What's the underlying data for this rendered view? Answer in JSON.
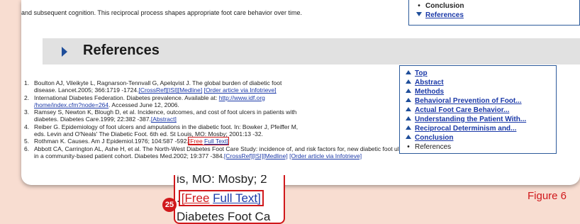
{
  "intro_text": "and subsequent cognition. This reciprocal process shapes appropriate foot care behavior over time.",
  "toc_top": {
    "items": [
      {
        "label": "Conclusion",
        "icon": "bullet-icon",
        "link": false
      },
      {
        "label": "References",
        "icon": "arrow-down-icon",
        "link": true
      }
    ]
  },
  "references_heading": "References",
  "references": [
    {
      "num": "1.",
      "line1": "Boulton AJ, Vileikyte L, Ragnarson-Tennvall G, Apelqvist J. The global burden of diabetic foot",
      "line2_text": "disease. Lancet.2005; 366:1719 -1724.",
      "links": [
        "[CrossRef]",
        "[ISI]",
        "[Medline]",
        "[Order article via Infotrieve]"
      ]
    },
    {
      "num": "2.",
      "line1_text": "International Diabetes Federation. Diabetes prevalence. Available at: ",
      "url1": "http://www.idf.org",
      "url2": "/home/index.cfm?node=264",
      "line2_text": ". Accessed June 12, 2006."
    },
    {
      "num": "3.",
      "line1": "Ramsey S, Newton K, Blough D, et al. Incidence, outcomes, and cost of foot ulcers in patients with",
      "line2_text": "diabetes. Diabetes Care.1999; 22:382 -387.",
      "links": [
        "[Abstract]"
      ]
    },
    {
      "num": "4.",
      "line1": "Reiber G. Epidemiology of foot ulcers and amputations in the diabetic foot. In: Bowker J, Pfeiffer M,",
      "line2": "eds. Levin and O'Neals' The Diabetic Foot. 6th ed. St Louis, MO: Mosby; 2001:13 -32."
    },
    {
      "num": "5.",
      "line1_text": "Rothman K. Causes. Am J Epidemiol.1976; 104:587 -592.",
      "link_free": "[Free",
      "link_fulltext": "Full Text]"
    },
    {
      "num": "6.",
      "line1": "Abbott CA, Carrington AL, Ashe H, et al. The North-West Diabetes Foot Care Study: incidence of, and risk factors for, new diabetic foot ulceration",
      "line2_text": "in a community-based patient cohort. Diabetes Med.2002; 19:377 -384.",
      "links": [
        "[CrossRef]",
        "[ISI]",
        "[Medline]",
        "[Order article via Infotrieve]"
      ]
    }
  ],
  "toc_box": {
    "items": [
      {
        "label": "Top",
        "icon": "arrow-up-icon",
        "link": true
      },
      {
        "label": "Abstract",
        "icon": "arrow-up-icon",
        "link": true
      },
      {
        "label": "Methods",
        "icon": "arrow-up-icon",
        "link": true
      },
      {
        "label": "Behavioral Prevention of Foot...",
        "icon": "arrow-up-icon",
        "link": true
      },
      {
        "label": "Actual Foot Care Behavior...",
        "icon": "arrow-up-icon",
        "link": true
      },
      {
        "label": "Understanding the Patient With...",
        "icon": "arrow-up-icon",
        "link": true
      },
      {
        "label": "Reciprocal Determinism and...",
        "icon": "arrow-up-icon",
        "link": true
      },
      {
        "label": "Conclusion",
        "icon": "arrow-up-icon",
        "link": true
      },
      {
        "label": "References",
        "icon": "bullet-icon",
        "link": false
      }
    ]
  },
  "zoom": {
    "line1": "is, MO: Mosby; 2",
    "line2_prefix": ".",
    "line2_free": "[Free",
    "line2_fulltext": "Full Text]",
    "line3": "Diabetes Foot Ca"
  },
  "callout_number": "25",
  "figure_label": "Figure 6",
  "colors": {
    "accent": "#d0181b",
    "link": "#1b39a8",
    "background": "#f8ddd1",
    "heading_bar": "#e1e1e1"
  }
}
